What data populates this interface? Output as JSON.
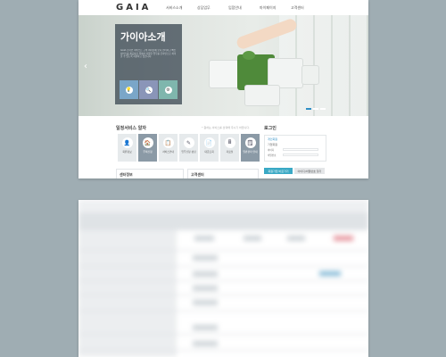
{
  "header": {
    "logo": "GAIA",
    "nav": [
      "서비스소개",
      "상담업무",
      "입점안내",
      "마이페이지",
      "고객센터"
    ]
  },
  "hero": {
    "title": "가이아소개",
    "description": "GAIA 온라인 서비스는 고객 여러분께 보다 편리하고 빠른 서비스를 제공하기 위하여 다양한 업무를 온라인으로 처리할 수 있도록 지원하고 있습니다.",
    "icons": [
      {
        "icon": "lightbulb-icon",
        "glyph": "💡"
      },
      {
        "icon": "search-icon",
        "glyph": "🔍"
      },
      {
        "icon": "gear-icon",
        "glyph": "⚙"
      }
    ],
    "prev_arrow": "‹"
  },
  "services": {
    "title": "일정서비스 알자",
    "note": "* 원하는 서비스를 선택해 주시기 바랍니다.",
    "items": [
      {
        "label": "회원정보",
        "glyph": "👤"
      },
      {
        "label": "주택신청",
        "glyph": "🏠"
      },
      {
        "label": "서비스안내",
        "glyph": "📋"
      },
      {
        "label": "입주신청 상담",
        "glyph": "✎"
      },
      {
        "label": "대금조회",
        "glyph": "📄"
      },
      {
        "label": "자료실",
        "glyph": "🖩"
      },
      {
        "label": "일반관리 안내",
        "glyph": "🗒"
      }
    ]
  },
  "login": {
    "title": "로그인",
    "options": [
      "개인회원",
      "기업회원"
    ],
    "fields": [
      "아이디",
      "비밀번호"
    ],
    "join_label": "회원가입 바로가기",
    "find_label": "아이디/비밀번호 찾기"
  },
  "sections": {
    "left": "센터정보",
    "right": "고객센터"
  }
}
